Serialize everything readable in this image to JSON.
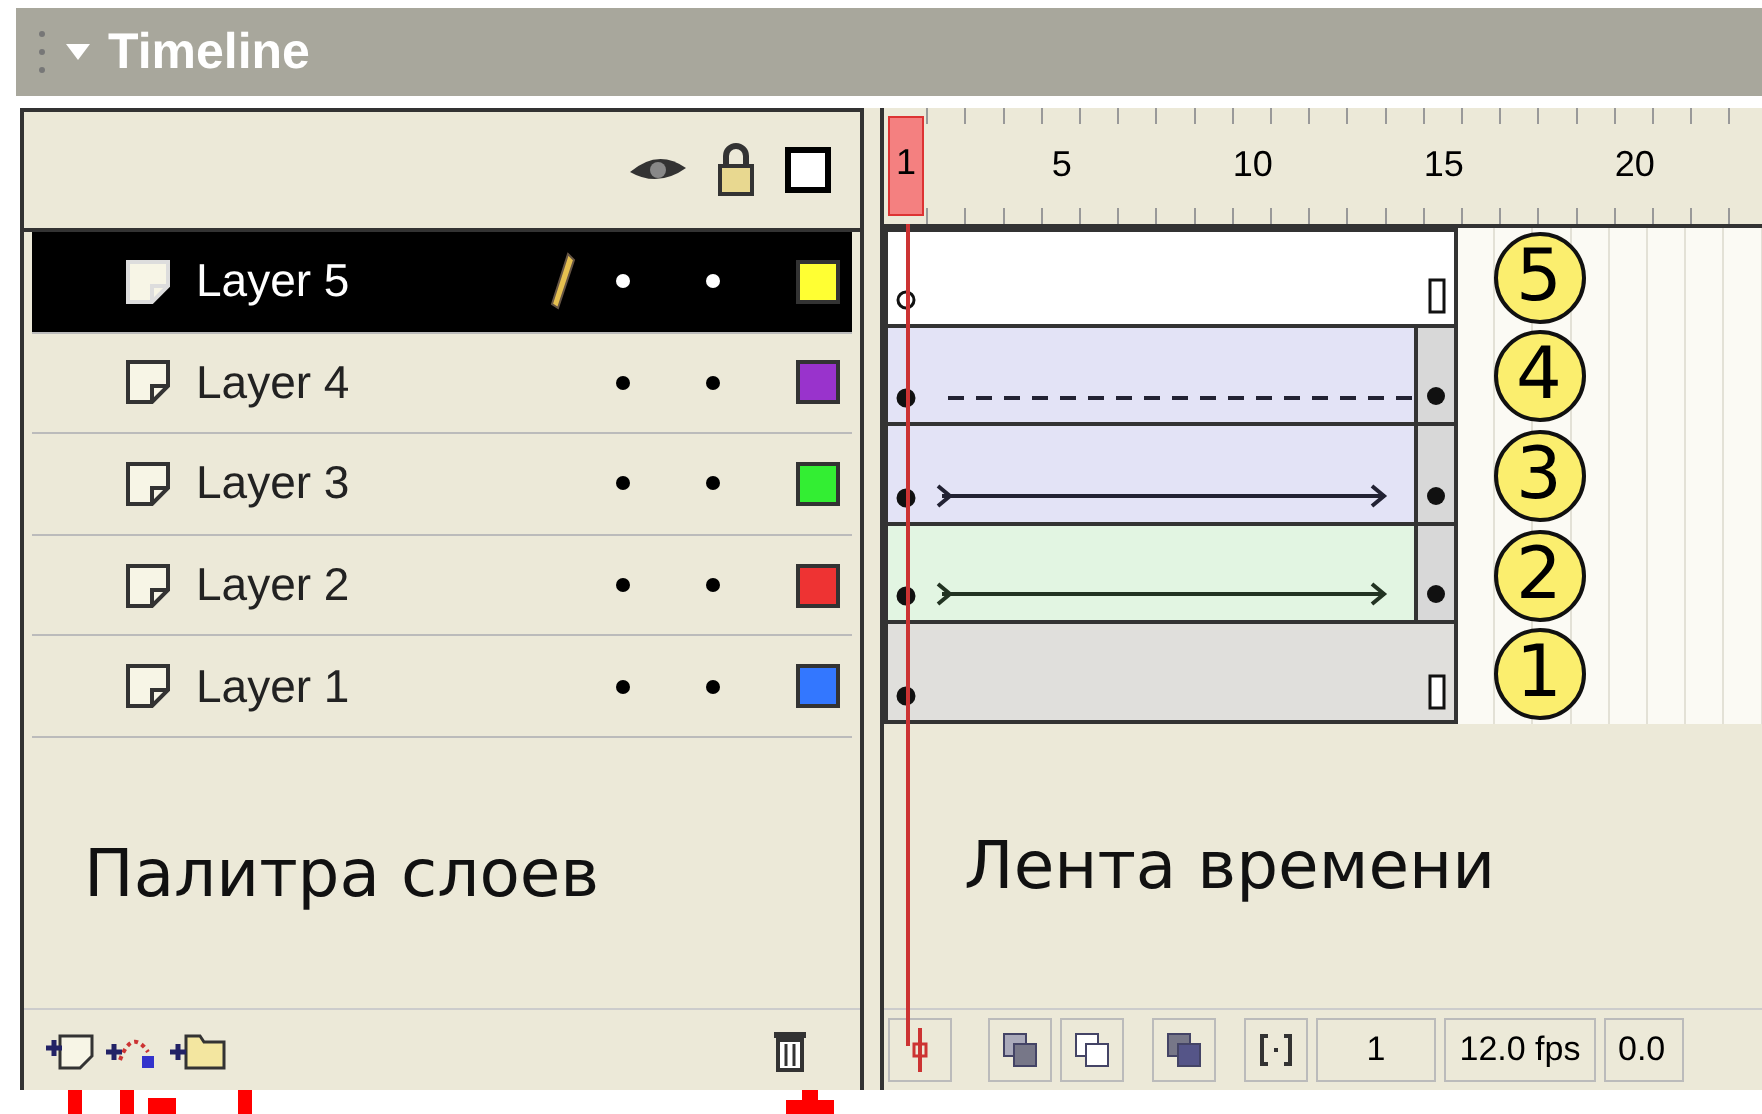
{
  "panel": {
    "title": "Timeline"
  },
  "ruler": {
    "current": "1",
    "labels": [
      "5",
      "10",
      "15",
      "20"
    ]
  },
  "layers": [
    {
      "name": "Layer 5",
      "selected": true,
      "editing": true,
      "color": "#ffff33",
      "kind": "blank",
      "badge": "5"
    },
    {
      "name": "Layer 4",
      "selected": false,
      "editing": false,
      "color": "#9933cc",
      "kind": "broken",
      "badge": "4"
    },
    {
      "name": "Layer 3",
      "selected": false,
      "editing": false,
      "color": "#33ee33",
      "kind": "motion",
      "badge": "3"
    },
    {
      "name": "Layer 2",
      "selected": false,
      "editing": false,
      "color": "#ee3333",
      "kind": "shape",
      "badge": "2"
    },
    {
      "name": "Layer 1",
      "selected": false,
      "editing": false,
      "color": "#3377ff",
      "kind": "static",
      "badge": "1"
    }
  ],
  "captions": {
    "layers": "Палитра слоев",
    "timeline": "Лента времени"
  },
  "status": {
    "frame": "1",
    "fps": "12.0 fps",
    "time": "0.0"
  }
}
